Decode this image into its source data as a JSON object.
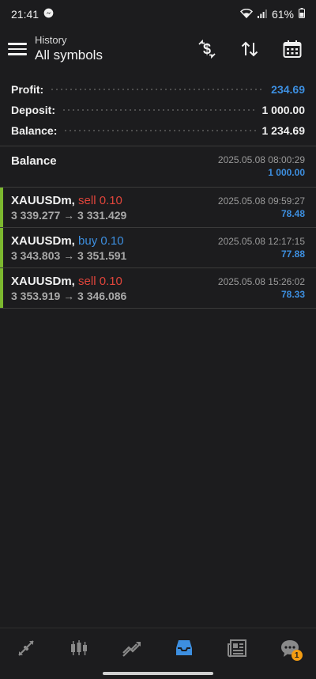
{
  "status_bar": {
    "time": "21:41",
    "battery": "61%"
  },
  "header": {
    "subtitle": "History",
    "title": "All symbols"
  },
  "summary": [
    {
      "label": "Profit:",
      "value": "234.69",
      "highlight": true
    },
    {
      "label": "Deposit:",
      "value": "1 000.00",
      "highlight": false
    },
    {
      "label": "Balance:",
      "value": "1 234.69",
      "highlight": false
    }
  ],
  "balance_entry": {
    "title": "Balance",
    "date": "2025.05.08 08:00:29",
    "amount": "1 000.00"
  },
  "deals": [
    {
      "symbol": "XAUUSDm,",
      "side": "sell 0.10",
      "prices": "3 339.277 → 3 331.429",
      "date": "2025.05.08 09:59:27",
      "profit": "78.48"
    },
    {
      "symbol": "XAUUSDm,",
      "side": "buy 0.10",
      "prices": "3 343.803 → 3 351.591",
      "date": "2025.05.08 12:17:15",
      "profit": "77.88"
    },
    {
      "symbol": "XAUUSDm,",
      "side": "sell 0.10",
      "prices": "3 353.919 → 3 346.086",
      "date": "2025.05.08 15:26:02",
      "profit": "78.33"
    }
  ],
  "nav": {
    "badge_count": "1"
  },
  "colors": {
    "accent": "#3d8fe0",
    "sell": "#e0453b",
    "buy": "#3d8fe0",
    "bar": "#7cb82f",
    "badge": "#f39c12"
  },
  "icons": [
    "messenger-icon",
    "wifi-icon",
    "signal-icon",
    "battery-icon",
    "menu-icon",
    "currency-exchange-icon",
    "sort-icon",
    "calendar-icon",
    "quotes-icon",
    "chart-icon",
    "trade-icon",
    "history-icon",
    "news-icon",
    "chat-icon"
  ]
}
